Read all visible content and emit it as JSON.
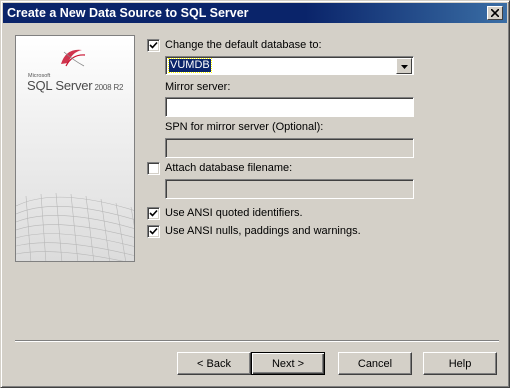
{
  "window": {
    "title": "Create a New Data Source to SQL Server"
  },
  "logo": {
    "microsoft": "Microsoft",
    "product": "SQL Server",
    "version": "2008 R2"
  },
  "options": {
    "change_default_db": {
      "label": "Change the default database to:",
      "checked": true
    },
    "database_value": "VUMDB",
    "mirror_server": {
      "label": "Mirror server:",
      "value": ""
    },
    "spn": {
      "label": "SPN for mirror server (Optional):",
      "value": ""
    },
    "attach_db": {
      "label": "Attach database filename:",
      "checked": false,
      "value": ""
    },
    "ansi_quoted": {
      "label": "Use ANSI quoted identifiers.",
      "checked": true
    },
    "ansi_nulls": {
      "label": "Use ANSI nulls, paddings and warnings.",
      "checked": true
    }
  },
  "buttons": {
    "back": "< Back",
    "next": "Next >",
    "cancel": "Cancel",
    "help": "Help"
  },
  "colors": {
    "title_bar": "#0a246a",
    "dialog_face": "#d4d0c8",
    "selection": "#0a246a"
  }
}
